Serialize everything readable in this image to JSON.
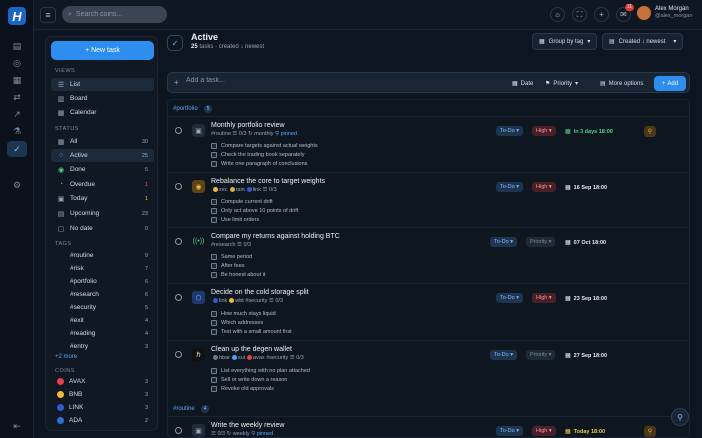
{
  "topbar": {
    "search_placeholder": "Search coins...",
    "notif_count": "11",
    "user_name": "Alex Morgan",
    "user_handle": "@alex_morgan"
  },
  "sidebar": {
    "new_task": "+ New task",
    "views_label": "VIEWS",
    "views": [
      {
        "label": "List"
      },
      {
        "label": "Board"
      },
      {
        "label": "Calendar"
      }
    ],
    "status_label": "STATUS",
    "status": [
      {
        "label": "All",
        "count": "30"
      },
      {
        "label": "Active",
        "count": "25"
      },
      {
        "label": "Done",
        "count": "5"
      },
      {
        "label": "Overdue",
        "count": "1"
      },
      {
        "label": "Today",
        "count": "1"
      },
      {
        "label": "Upcoming",
        "count": "23"
      },
      {
        "label": "No date",
        "count": "0"
      }
    ],
    "tags_label": "TAGS",
    "tags": [
      {
        "label": "#routine",
        "count": "9"
      },
      {
        "label": "#risk",
        "count": "7"
      },
      {
        "label": "#portfolio",
        "count": "6"
      },
      {
        "label": "#research",
        "count": "6"
      },
      {
        "label": "#security",
        "count": "5"
      },
      {
        "label": "#exit",
        "count": "4"
      },
      {
        "label": "#reading",
        "count": "4"
      },
      {
        "label": "#entry",
        "count": "3"
      }
    ],
    "tags_more": "+2 more",
    "coins_label": "COINS",
    "coins": [
      {
        "label": "AVAX",
        "count": "3",
        "color": "#e84142"
      },
      {
        "label": "BNB",
        "count": "3",
        "color": "#f3ba2f"
      },
      {
        "label": "LINK",
        "count": "3",
        "color": "#2a5ada"
      },
      {
        "label": "ADA",
        "count": "2",
        "color": "#2a71d0"
      }
    ]
  },
  "header": {
    "title": "Active",
    "count": "25",
    "subtitle": "tasks · created ↓ newest",
    "group_btn": "Group by tag",
    "sort_btn": "Created ↓ newest"
  },
  "addbar": {
    "placeholder": "Add a task...",
    "date": "Date",
    "priority": "Priority",
    "more": "More options",
    "add": "Add"
  },
  "groups": [
    {
      "label": "#portfolio",
      "count": "5"
    },
    {
      "label": "#routine",
      "count": "4"
    }
  ],
  "tasks": [
    {
      "title": "Monthly portfolio review",
      "meta_tag": "#routine",
      "meta_sub": "0/3",
      "meta_repeat": "monthly",
      "meta_pinned": "pinned",
      "subtasks": [
        "Compare targets against actual weights",
        "Check the trading book separately",
        "Write one paragraph of conclusions"
      ],
      "status": "To-Do",
      "priority": "High",
      "due": "In 3 days 18:00"
    },
    {
      "title": "Rebalance the core to target weights",
      "coins": [
        "zec",
        "rain",
        "link"
      ],
      "meta_sub": "0/3",
      "subtasks": [
        "Compute current drift",
        "Only act above 10 points of drift",
        "Use limit orders"
      ],
      "status": "To-Do",
      "priority": "High",
      "due": "16 Sep 18:00"
    },
    {
      "title": "Compare my returns against holding BTC",
      "meta_tag": "#research",
      "meta_sub": "0/3",
      "subtasks": [
        "Same period",
        "After fees",
        "Be honest about it"
      ],
      "status": "To-Do",
      "priority": "Priority",
      "due": "07 Oct 18:00"
    },
    {
      "title": "Decide on the cold storage split",
      "coins": [
        "link",
        "wbt"
      ],
      "meta_tag": "#security",
      "meta_sub": "0/3",
      "subtasks": [
        "How much stays liquid",
        "Which addresses",
        "Test with a small amount first"
      ],
      "status": "To-Do",
      "priority": "High",
      "due": "23 Sep 18:00"
    },
    {
      "title": "Clean up the degen wallet",
      "coins": [
        "hbar",
        "sui",
        "avax"
      ],
      "meta_tag": "#security",
      "meta_sub": "0/3",
      "subtasks": [
        "List everything with no plan attached",
        "Sell or write down a reason",
        "Revoke old approvals"
      ],
      "status": "To-Do",
      "priority": "Priority",
      "due": "27 Sep 18:00"
    },
    {
      "title": "Write the weekly review",
      "meta_sub": "0/3",
      "meta_repeat": "weekly",
      "meta_pinned": "pinned",
      "status": "To-Do",
      "priority": "High",
      "due": "Today 18:00"
    }
  ]
}
